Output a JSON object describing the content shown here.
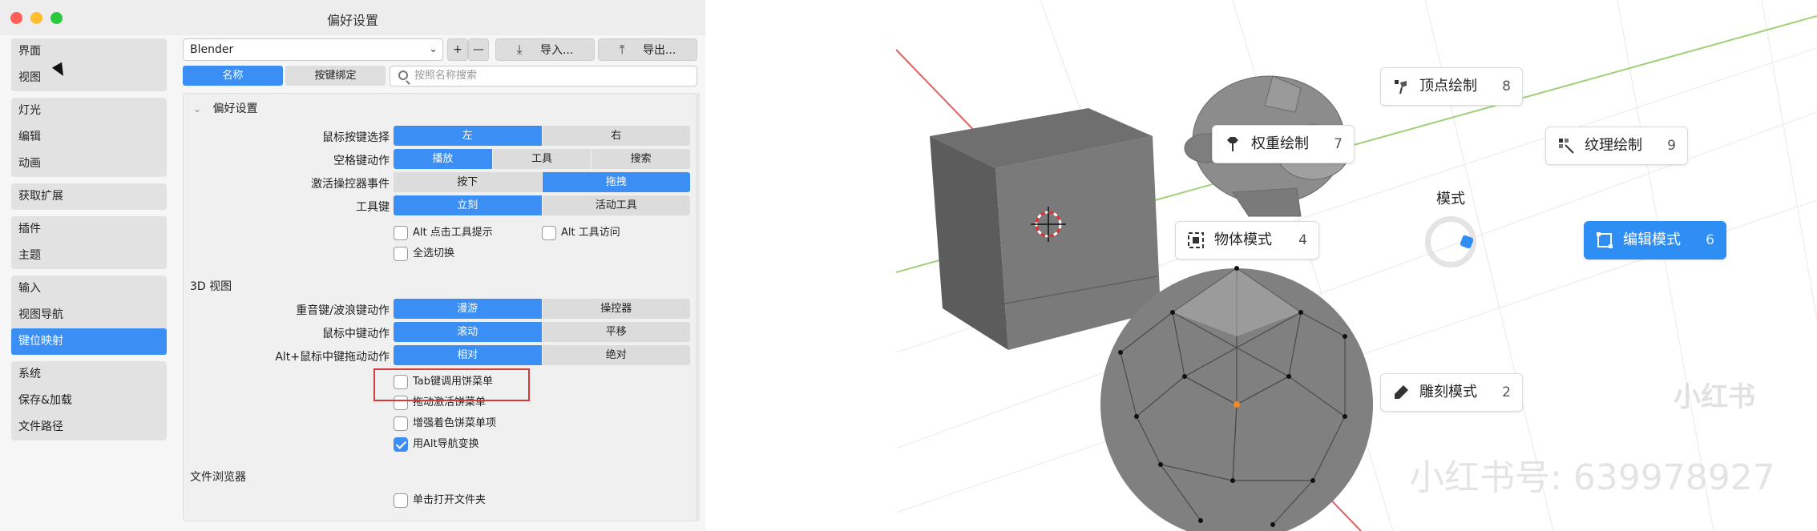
{
  "window": {
    "title": "偏好设置"
  },
  "sidebar": {
    "groups": [
      [
        "界面",
        "视图"
      ],
      [
        "灯光",
        "编辑",
        "动画"
      ],
      [
        "获取扩展"
      ],
      [
        "插件",
        "主题"
      ],
      [
        "输入",
        "视图导航",
        "键位映射"
      ],
      [
        "系统",
        "保存&加载",
        "文件路径"
      ]
    ],
    "active": "键位映射"
  },
  "header": {
    "preset": "Blender",
    "add": "+",
    "remove": "—",
    "import_label": "导入...",
    "export_label": "导出..."
  },
  "tabs": {
    "name": "名称",
    "key_binding": "按键绑定"
  },
  "search": {
    "placeholder": "按照名称搜索"
  },
  "prefs": {
    "section_title": "偏好设置",
    "rows": [
      {
        "label": "鼠标按键选择",
        "options": [
          "左",
          "右"
        ],
        "selected": 0
      },
      {
        "label": "空格键动作",
        "options": [
          "播放",
          "工具",
          "搜索"
        ],
        "selected": 0
      },
      {
        "label": "激活操控器事件",
        "options": [
          "按下",
          "拖拽"
        ],
        "selected": 1
      },
      {
        "label": "工具键",
        "options": [
          "立刻",
          "活动工具"
        ],
        "selected": 0
      }
    ],
    "checkboxes": [
      {
        "label": "Alt 点击工具提示",
        "checked": false
      },
      {
        "label": "Alt 工具访问",
        "checked": false
      },
      {
        "label": "全选切换",
        "checked": false
      }
    ]
  },
  "view3d": {
    "section_title": "3D 视图",
    "rows": [
      {
        "label": "重音键/波浪键动作",
        "options": [
          "漫游",
          "操控器"
        ],
        "selected": 0
      },
      {
        "label": "鼠标中键动作",
        "options": [
          "滚动",
          "平移"
        ],
        "selected": 0
      },
      {
        "label": "Alt+鼠标中键拖动动作",
        "options": [
          "相对",
          "绝对"
        ],
        "selected": 0
      }
    ],
    "checkboxes": [
      {
        "label": "Tab键调用饼菜单",
        "checked": false
      },
      {
        "label": "拖动激活饼菜单",
        "checked": false
      },
      {
        "label": "增强着色饼菜单项",
        "checked": false
      },
      {
        "label": "用Alt导航变换",
        "checked": true
      }
    ]
  },
  "file_browser": {
    "section_title": "文件浏览器",
    "checkbox": {
      "label": "单击打开文件夹",
      "checked": false
    }
  },
  "pie_menu": {
    "title": "模式",
    "items": [
      {
        "label": "顶点绘制",
        "num": "8",
        "icon": "vertex-paint-icon"
      },
      {
        "label": "权重绘制",
        "num": "7",
        "icon": "weight-paint-icon"
      },
      {
        "label": "纹理绘制",
        "num": "9",
        "icon": "texture-paint-icon"
      },
      {
        "label": "物体模式",
        "num": "4",
        "icon": "object-mode-icon"
      },
      {
        "label": "编辑模式",
        "num": "6",
        "icon": "edit-mode-icon",
        "highlighted": true
      },
      {
        "label": "雕刻模式",
        "num": "2",
        "icon": "sculpt-mode-icon"
      }
    ]
  },
  "watermark": {
    "logo": "小红书",
    "id_text": "小红书号: 639978927"
  },
  "colors": {
    "accent": "#3b8ef4",
    "highlight_box": "#d23b3b"
  }
}
